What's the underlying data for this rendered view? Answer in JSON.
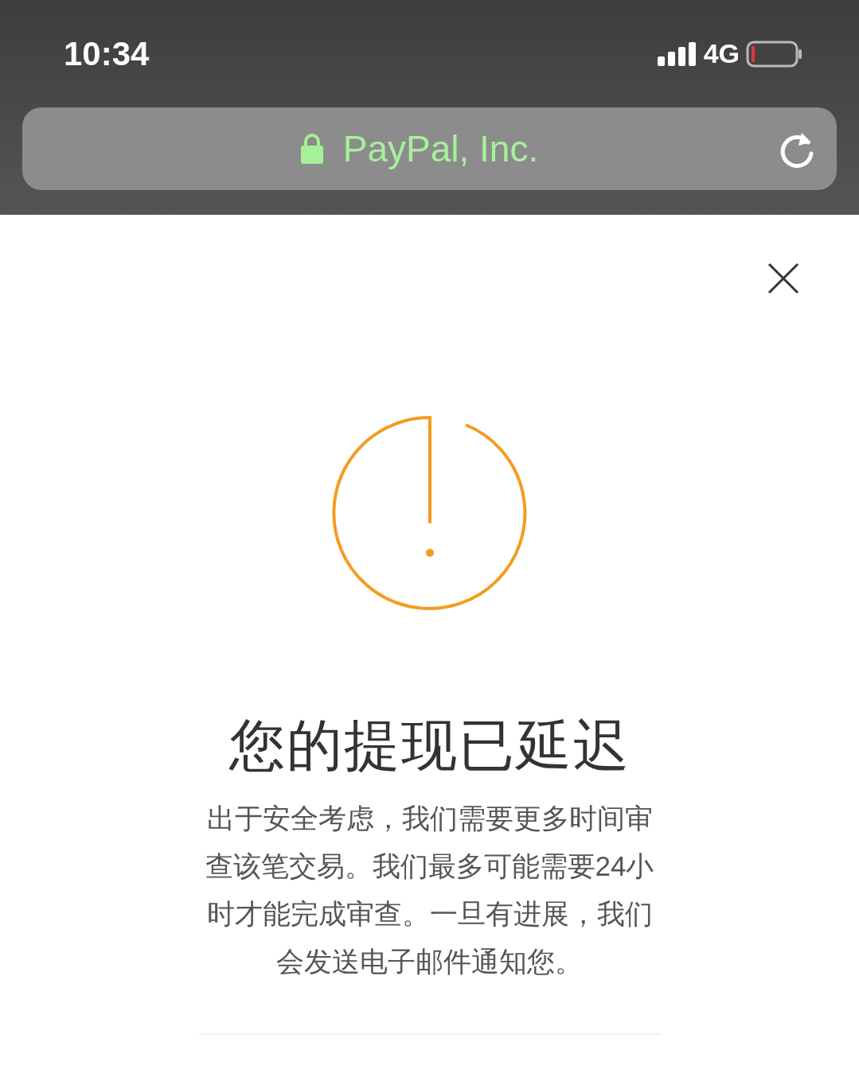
{
  "status_bar": {
    "time": "10:34",
    "network": "4G"
  },
  "address_bar": {
    "site": "PayPal, Inc."
  },
  "dialog": {
    "title": "您的提现已延迟",
    "message": "出于安全考虑，我们需要更多时间审查该笔交易。我们最多可能需要24小时才能完成审查。一旦有进展，我们会发送电子邮件通知您。"
  }
}
